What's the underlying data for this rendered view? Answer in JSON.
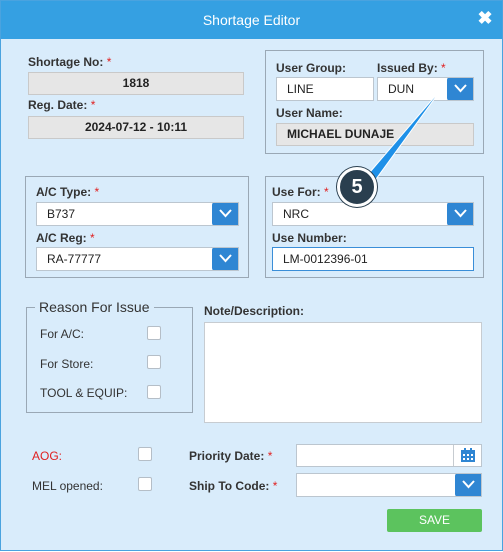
{
  "dialog": {
    "title": "Shortage Editor",
    "close_icon": "close-icon"
  },
  "shortage": {
    "shortage_no_label": "Shortage No:",
    "shortage_no_value": "1818",
    "reg_date_label": "Reg. Date:",
    "reg_date_value": "2024-07-12 - 10:11",
    "required_mark": "*"
  },
  "user": {
    "user_group_label": "User Group:",
    "user_group_value": "LINE",
    "issued_by_label": "Issued By:",
    "issued_by_value": "DUN",
    "user_name_label": "User Name:",
    "user_name_value": "MICHAEL DUNAJE"
  },
  "aircraft": {
    "ac_type_label": "A/C Type:",
    "ac_type_value": "B737",
    "ac_reg_label": "A/C Reg:",
    "ac_reg_value": "RA-77777"
  },
  "use": {
    "use_for_label": "Use For:",
    "use_for_value": "NRC",
    "use_number_label": "Use Number:",
    "use_number_value": "LM-0012396-01"
  },
  "reason": {
    "legend": "Reason For Issue",
    "for_ac_label": "For A/C:",
    "for_store_label": "For Store:",
    "tool_equip_label": "TOOL & EQUIP:"
  },
  "note": {
    "label": "Note/Description:",
    "value": ""
  },
  "flags": {
    "aog_label": "AOG:",
    "mel_opened_label": "MEL opened:",
    "aog_color": "#e02020"
  },
  "shipping": {
    "priority_date_label": "Priority Date:",
    "priority_date_value": "",
    "ship_to_code_label": "Ship To Code:",
    "ship_to_code_value": ""
  },
  "actions": {
    "save_label": "SAVE"
  },
  "annotation": {
    "step_number": "5"
  },
  "colors": {
    "accent": "#35a0e2",
    "dropdown": "#2f86d3",
    "save": "#5cc35e",
    "background": "#d9ecfb"
  }
}
